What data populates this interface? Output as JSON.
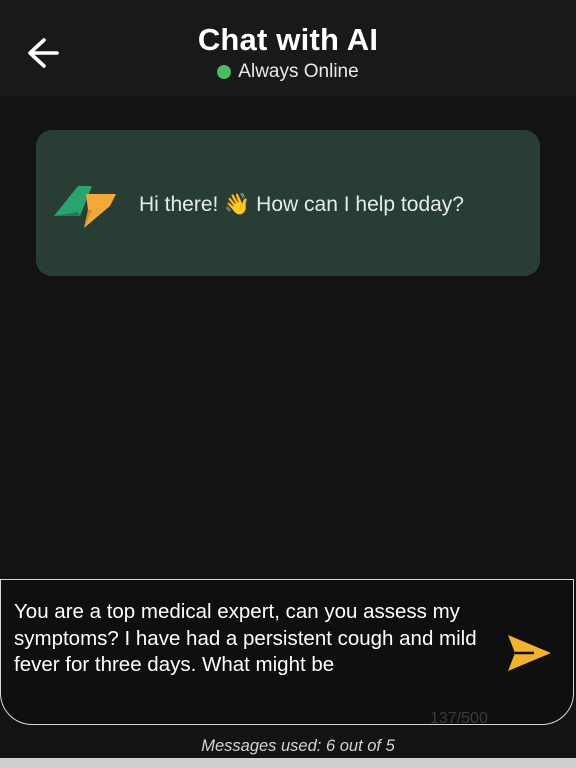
{
  "header": {
    "back_icon": "arrow-left-icon",
    "title": "Chat with AI",
    "status_text": "Always Online",
    "status_color": "#4dbb62"
  },
  "messages": [
    {
      "sender": "bot",
      "text": "Hi there! 👋 How can I help today?",
      "bubble_color": "#283e34"
    }
  ],
  "composer": {
    "value": "You are a top medical expert, can you assess my symptoms? I have had a persistent cough and mild fever for three days. What might be",
    "char_count": "137/500",
    "send_icon": "send-icon",
    "send_color": "#f2b230"
  },
  "footer": {
    "usage_text": "Messages used: 6 out of 5"
  }
}
